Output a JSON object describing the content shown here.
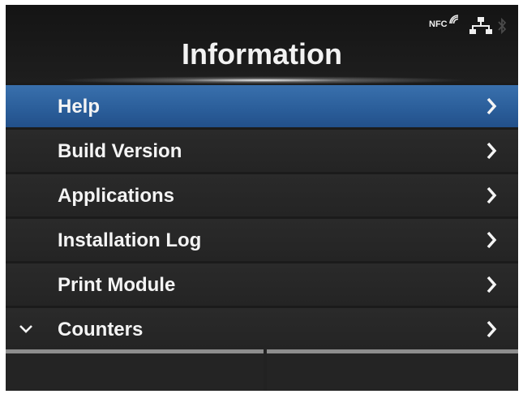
{
  "header": {
    "title": "Information",
    "status": {
      "nfc_label": "NFC",
      "icons": [
        "nfc-icon",
        "network-icon",
        "bluetooth-icon"
      ]
    }
  },
  "menu": {
    "items": [
      {
        "label": "Help",
        "selected": true
      },
      {
        "label": "Build Version",
        "selected": false
      },
      {
        "label": "Applications",
        "selected": false
      },
      {
        "label": "Installation Log",
        "selected": false
      },
      {
        "label": "Print Module",
        "selected": false
      },
      {
        "label": "Counters",
        "selected": false,
        "more_below": true
      }
    ]
  },
  "softkeys": {
    "left": "",
    "right": ""
  },
  "colors": {
    "background": "#1b1b1b",
    "selected": "#2a5d99",
    "text": "#f4f4f4",
    "softkey_top": "#8e8e8e"
  }
}
